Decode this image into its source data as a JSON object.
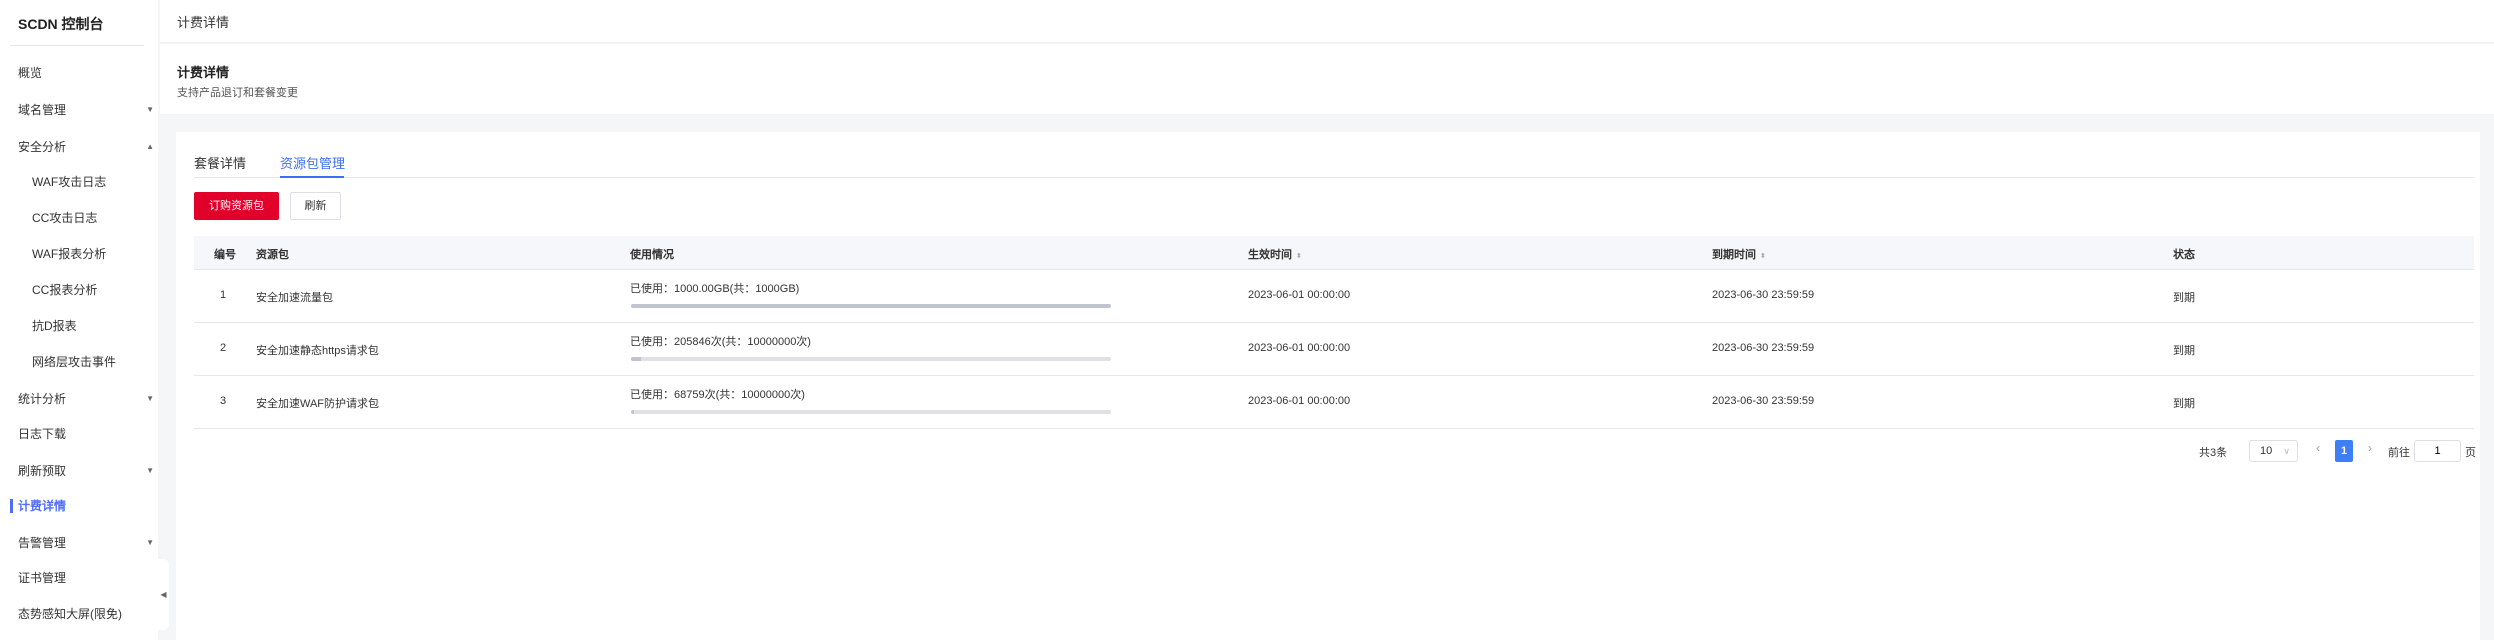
{
  "sidebar": {
    "title": "SCDN 控制台",
    "items": [
      {
        "label": "概览"
      },
      {
        "label": "域名管理",
        "caret": "▼"
      },
      {
        "label": "安全分析",
        "caret": "▲"
      },
      {
        "label": "WAF攻击日志"
      },
      {
        "label": "CC攻击日志"
      },
      {
        "label": "WAF报表分析"
      },
      {
        "label": "CC报表分析"
      },
      {
        "label": "抗D报表"
      },
      {
        "label": "网络层攻击事件"
      },
      {
        "label": "统计分析",
        "caret": "▼"
      },
      {
        "label": "日志下载"
      },
      {
        "label": "刷新预取",
        "caret": "▼"
      },
      {
        "label": "计费详情"
      },
      {
        "label": "告警管理",
        "caret": "▼"
      },
      {
        "label": "证书管理"
      },
      {
        "label": "态势感知大屏(限免)"
      }
    ],
    "collapse_icon": "◀"
  },
  "breadcrumb": "计费详情",
  "page_header": {
    "title": "计费详情",
    "subtitle": "支持产品退订和套餐变更"
  },
  "tabs": [
    {
      "label": "套餐详情"
    },
    {
      "label": "资源包管理"
    }
  ],
  "toolbar": {
    "order_label": "订购资源包",
    "refresh_label": "刷新"
  },
  "table": {
    "columns": [
      "编号",
      "资源包",
      "使用情况",
      "生效时间",
      "到期时间",
      "状态"
    ],
    "sort_icon": "⬍",
    "rows": [
      {
        "no": "1",
        "name": "安全加速流量包",
        "usage": "已使用：1000.00GB(共：1000GB)",
        "used_fraction": 1.0,
        "start": "2023-06-01 00:00:00",
        "end": "2023-06-30 23:59:59",
        "status": "到期"
      },
      {
        "no": "2",
        "name": "安全加速静态https请求包",
        "usage": "已使用：205846次(共：10000000次)",
        "used_fraction": 0.0206,
        "start": "2023-06-01 00:00:00",
        "end": "2023-06-30 23:59:59",
        "status": "到期"
      },
      {
        "no": "3",
        "name": "安全加速WAF防护请求包",
        "usage": "已使用：68759次(共：10000000次)",
        "used_fraction": 0.0069,
        "start": "2023-06-01 00:00:00",
        "end": "2023-06-30 23:59:59",
        "status": "到期"
      }
    ]
  },
  "pagination": {
    "total": "共3条",
    "page_size": "10",
    "prev": "‹",
    "current": "1",
    "next": "›",
    "goto_label": "前往",
    "goto_value": "1",
    "page_unit": "页"
  },
  "colors": {
    "accent": "#3d7ff5",
    "primary_button": "#e1002a",
    "active_nav": "#4f6ef7"
  }
}
